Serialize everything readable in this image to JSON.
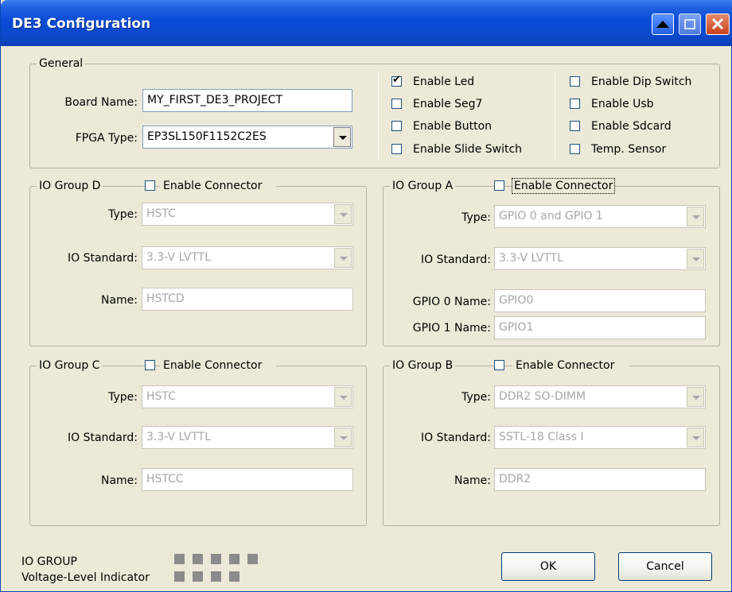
{
  "window": {
    "title": "DE3 Configuration"
  },
  "general": {
    "legend": "General",
    "board_name_label": "Board Name:",
    "board_name_value": "MY_FIRST_DE3_PROJECT",
    "fpga_type_label": "FPGA Type:",
    "fpga_type_value": "EP3SL150F1152C2ES",
    "checks_left": [
      {
        "label": "Enable Led",
        "checked": true
      },
      {
        "label": "Enable Seg7",
        "checked": false
      },
      {
        "label": "Enable Button",
        "checked": false
      },
      {
        "label": "Enable Slide Switch",
        "checked": false
      }
    ],
    "checks_right": [
      {
        "label": "Enable Dip Switch",
        "checked": false
      },
      {
        "label": "Enable Usb",
        "checked": false
      },
      {
        "label": "Enable Sdcard",
        "checked": false
      },
      {
        "label": "Temp. Sensor",
        "checked": false
      }
    ]
  },
  "groups": {
    "d": {
      "legend": "IO Group D",
      "enable_label": "Enable Connector",
      "type_label": "Type:",
      "type_value": "HSTC",
      "std_label": "IO Standard:",
      "std_value": "3.3-V LVTTL",
      "name_label": "Name:",
      "name_value": "HSTCD"
    },
    "a": {
      "legend": "IO Group A",
      "enable_label": "Enable Connector",
      "type_label": "Type:",
      "type_value": "GPIO 0 and GPIO 1",
      "std_label": "IO Standard:",
      "std_value": "3.3-V LVTTL",
      "gpio0_label": "GPIO 0 Name:",
      "gpio0_value": "GPIO0",
      "gpio1_label": "GPIO 1 Name:",
      "gpio1_value": "GPIO1"
    },
    "c": {
      "legend": "IO Group C",
      "enable_label": "Enable Connector",
      "type_label": "Type:",
      "type_value": "HSTC",
      "std_label": "IO Standard:",
      "std_value": "3.3-V LVTTL",
      "name_label": "Name:",
      "name_value": "HSTCC"
    },
    "b": {
      "legend": "IO Group B",
      "enable_label": "Enable Connector",
      "type_label": "Type:",
      "type_value": "DDR2 SO-DIMM",
      "std_label": "IO Standard:",
      "std_value": "SSTL-18 Class I",
      "name_label": "Name:",
      "name_value": "DDR2"
    }
  },
  "footer": {
    "indicator_line1": "IO GROUP",
    "indicator_line2": "Voltage-Level Indicator",
    "ok_label": "OK",
    "cancel_label": "Cancel"
  },
  "colors": {
    "titlebar": "#0b48c9",
    "dialog_bg": "#ece9d8",
    "indicator": "#8b8b8b"
  }
}
